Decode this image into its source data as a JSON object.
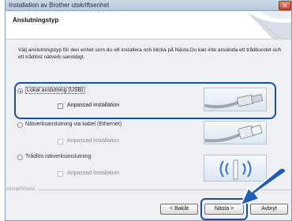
{
  "window": {
    "title": "Installation av Brother utskriftsenhet",
    "close_glyph": "✕"
  },
  "header": {
    "title": "Anslutningstyp"
  },
  "intro_text": "Välj anslutningstyp för den enhet som du vill installera och klicka på Nästa.Du kan inte använda ett trådbundet och ett trådlöst nätverk samtidigt.",
  "options": [
    {
      "label": "Lokal anslutning (USB)",
      "selected": true,
      "checkbox_label": "Anpassad installation",
      "checkbox_enabled": true,
      "icon": "usb-cable-icon"
    },
    {
      "label": "Nätverksanslutning via kabel (Ethernet)",
      "selected": false,
      "checkbox_label": "Anpassad installation",
      "checkbox_enabled": false,
      "icon": "ethernet-cable-icon"
    },
    {
      "label": "Trådlös nätverksanslutning",
      "selected": false,
      "checkbox_label": "Anpassad installation",
      "checkbox_enabled": false,
      "icon": "wireless-icon"
    }
  ],
  "footer": {
    "brand": "InstallShield",
    "back_label": "< Bakåt",
    "next_label": "Nästa >",
    "cancel_label": "Avbryt"
  },
  "colors": {
    "highlight": "#1a4fa0",
    "arrow": "#1f5fb4"
  }
}
